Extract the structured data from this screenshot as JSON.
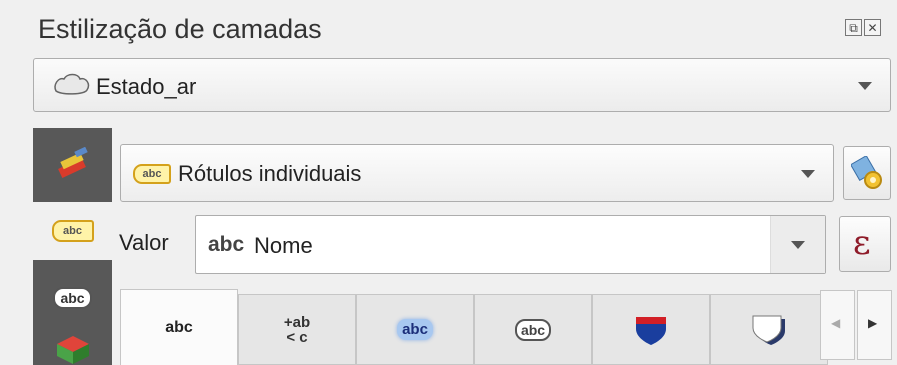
{
  "panel": {
    "title": "Estilização de camadas",
    "float_glyph": "⧉",
    "close_glyph": "✕"
  },
  "layer": {
    "name": "Estado_ar"
  },
  "renderer": {
    "selected": "Rótulos individuais",
    "badge": "abc"
  },
  "value": {
    "label": "Valor",
    "type_prefix": "abc",
    "field": "Nome",
    "expression_glyph": "ε"
  },
  "sidebar": {
    "items": [
      {
        "icon": "symbology-brush-icon"
      },
      {
        "icon": "labels-icon",
        "badge": "abc"
      },
      {
        "icon": "masks-icon",
        "badge": "abc"
      },
      {
        "icon": "3d-view-icon"
      }
    ]
  },
  "tabs": {
    "items": [
      {
        "icon": "text-icon",
        "label": "abc"
      },
      {
        "icon": "formatting-icon",
        "line1": "+ab",
        "line2": "< c"
      },
      {
        "icon": "buffer-icon",
        "label": "abc"
      },
      {
        "icon": "mask-icon",
        "label": "abc"
      },
      {
        "icon": "background-shield-icon"
      },
      {
        "icon": "shadow-icon"
      }
    ],
    "scroll_left": "◀",
    "scroll_right": "▶"
  },
  "colors": {
    "sidebar": "#585858",
    "expression": "#8f1c2a",
    "shield_red": "#d21f26",
    "shield_blue": "#1a3e9e",
    "badge_yellow": "#fff3a8"
  }
}
